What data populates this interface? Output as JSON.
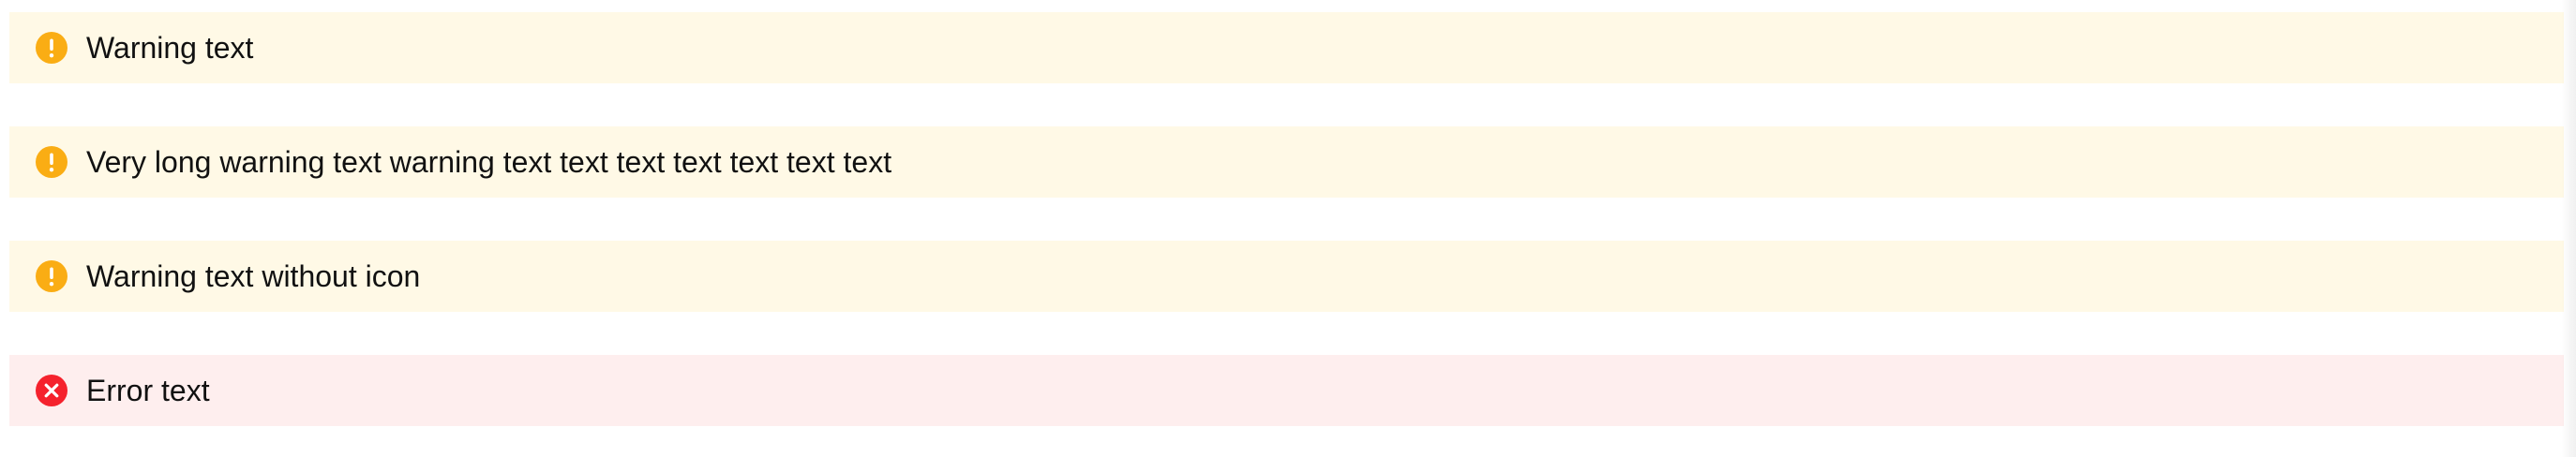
{
  "alerts": [
    {
      "type": "warning",
      "icon": "exclamation-icon",
      "text": "Warning text"
    },
    {
      "type": "warning",
      "icon": "exclamation-icon",
      "text": "Very long warning text warning text text text text text text text"
    },
    {
      "type": "warning",
      "icon": "exclamation-icon",
      "text": "Warning text without icon"
    },
    {
      "type": "error",
      "icon": "close-icon",
      "text": "Error text"
    }
  ],
  "colors": {
    "warning_bg": "#fff9e6",
    "warning_icon": "#faad14",
    "error_bg": "#feeeee",
    "error_icon": "#f5222d",
    "text": "#111111"
  }
}
